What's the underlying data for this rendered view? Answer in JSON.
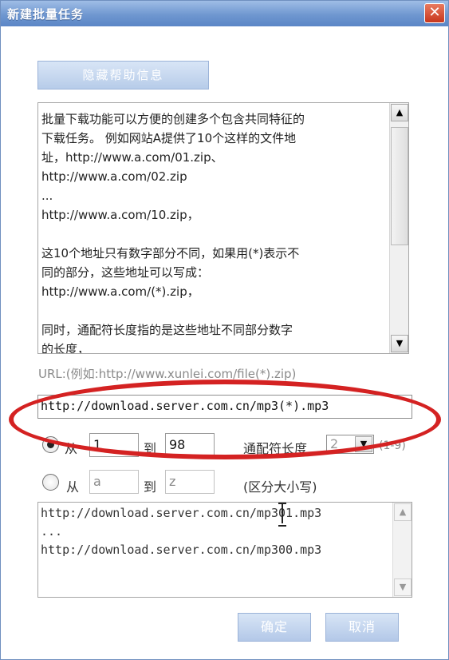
{
  "window": {
    "title": "新建批量任务",
    "close_label": "✕"
  },
  "help_button_label": "隐藏帮助信息",
  "help_text": {
    "lines": [
      "  批量下载功能可以方便的创建多个包含共同特征的",
      "下载任务。 例如网站A提供了10个这样的文件地",
      "址，http://www.a.com/01.zip、",
      "      http://www.a.com/02.zip",
      "      ...",
      "      http://www.a.com/10.zip，",
      "",
      "  这10个地址只有数字部分不同，如果用(*)表示不",
      "同的部分，这些地址可以写成：",
      "   http://www.a.com/(*).zip，",
      "",
      "  同时，通配符长度指的是这些地址不同部分数字",
      "的长度，"
    ]
  },
  "url_hint": "URL:(例如:http://www.xunlei.com/file(*).zip)",
  "url_value": "http://download.server.com.cn/mp3(*).mp3",
  "numeric_row": {
    "from_label": "从",
    "from_value": "1",
    "to_label": "到",
    "to_value": "98",
    "wildcard_label": "通配符长度",
    "wildcard_value": "2",
    "range_hint": "(1-9)"
  },
  "alpha_row": {
    "from_label": "从",
    "from_value": "a",
    "to_label": "到",
    "to_value": "z",
    "case_hint": "(区分大小写)"
  },
  "result_lines": [
    "http://download.server.com.cn/mp301.mp3",
    "...",
    "http://download.server.com.cn/mp300.mp3"
  ],
  "buttons": {
    "ok": "确定",
    "cancel": "取消"
  },
  "colors": {
    "titlebar": "#6f97d0",
    "annotation_oval": "#d42222",
    "close_button": "#c7361c"
  }
}
